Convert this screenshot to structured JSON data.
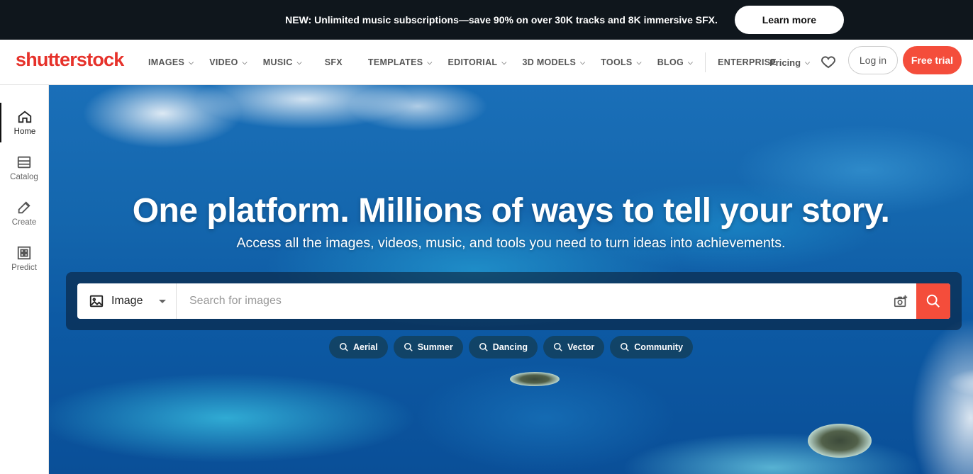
{
  "promo": {
    "text": "NEW: Unlimited music subscriptions—save 90% on over 30K tracks and 8K immersive SFX.",
    "button": "Learn more"
  },
  "header": {
    "logo": "shutterstock",
    "nav": [
      {
        "label": "IMAGES",
        "chevron": true
      },
      {
        "label": "VIDEO",
        "chevron": true
      },
      {
        "label": "MUSIC",
        "chevron": true
      },
      {
        "label": "SFX",
        "chevron": false
      },
      {
        "label": "TEMPLATES",
        "chevron": true
      },
      {
        "label": "EDITORIAL",
        "chevron": true
      },
      {
        "label": "3D MODELS",
        "chevron": true
      },
      {
        "label": "TOOLS",
        "chevron": true
      },
      {
        "label": "BLOG",
        "chevron": true
      },
      {
        "label": "ENTERPRISE",
        "chevron": false
      }
    ],
    "pricing": "Pricing",
    "login": "Log in",
    "trial": "Free trial"
  },
  "sidebar": {
    "items": [
      {
        "label": "Home",
        "icon": "home-icon",
        "active": true
      },
      {
        "label": "Catalog",
        "icon": "catalog-icon",
        "active": false
      },
      {
        "label": "Create",
        "icon": "create-icon",
        "active": false
      },
      {
        "label": "Predict",
        "icon": "predict-icon",
        "active": false
      }
    ]
  },
  "hero": {
    "title": "One platform. Millions of ways to tell your story.",
    "subtitle": "Access all the images, videos, music, and tools you need to turn ideas into achievements."
  },
  "search": {
    "type": "Image",
    "placeholder": "Search for images"
  },
  "chips": [
    "Aerial",
    "Summer",
    "Dancing",
    "Vector",
    "Community"
  ],
  "colors": {
    "brand": "#e6322b",
    "accent": "#f44d3b",
    "banner": "#0f161c"
  }
}
